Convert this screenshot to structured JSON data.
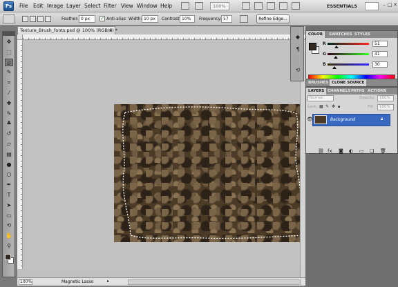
{
  "menubar": {
    "logo": "Ps",
    "items": [
      "File",
      "Edit",
      "Image",
      "Layer",
      "Select",
      "Filter",
      "View",
      "Window",
      "Help"
    ],
    "zoom": "100%",
    "workspace": "ESSENTIALS",
    "window_controls": [
      "–",
      "□",
      "✕"
    ]
  },
  "options": {
    "feather_label": "Feather:",
    "feather_value": "0 px",
    "antialias_label": "Anti-alias",
    "width_label": "Width:",
    "width_value": "10 px",
    "contrast_label": "Contrast:",
    "contrast_value": "10%",
    "frequency_label": "Frequency:",
    "frequency_value": "57",
    "refine_label": "Refine Edge..."
  },
  "toolbox": {
    "tools": [
      {
        "name": "move-tool-icon",
        "glyph": "✥"
      },
      {
        "name": "marquee-tool-icon",
        "glyph": "⬚"
      },
      {
        "name": "lasso-tool-icon",
        "glyph": "ᘐ"
      },
      {
        "name": "quick-selection-tool-icon",
        "glyph": "✎"
      },
      {
        "name": "crop-tool-icon",
        "glyph": "⌗"
      },
      {
        "name": "eyedropper-tool-icon",
        "glyph": "⁄"
      },
      {
        "name": "healing-brush-tool-icon",
        "glyph": "✚"
      },
      {
        "name": "brush-tool-icon",
        "glyph": "✎"
      },
      {
        "name": "clone-stamp-tool-icon",
        "glyph": "♣"
      },
      {
        "name": "history-brush-tool-icon",
        "glyph": "↺"
      },
      {
        "name": "eraser-tool-icon",
        "glyph": "▱"
      },
      {
        "name": "gradient-tool-icon",
        "glyph": "▤"
      },
      {
        "name": "blur-tool-icon",
        "glyph": "●"
      },
      {
        "name": "dodge-tool-icon",
        "glyph": "○"
      },
      {
        "name": "pen-tool-icon",
        "glyph": "✒"
      },
      {
        "name": "type-tool-icon",
        "glyph": "T"
      },
      {
        "name": "path-selection-tool-icon",
        "glyph": "➤"
      },
      {
        "name": "shape-tool-icon",
        "glyph": "▭"
      },
      {
        "name": "3d-rotate-tool-icon",
        "glyph": "⟲"
      },
      {
        "name": "hand-tool-icon",
        "glyph": "✋"
      },
      {
        "name": "zoom-tool-icon",
        "glyph": "⚲"
      }
    ],
    "active_tool_index": 2,
    "foreground_color": "#33291e",
    "background_color": "#ffffff"
  },
  "document": {
    "tab_title": "Texture_Brush_fonts.psd @ 100% (RGB/8) *",
    "close_glyph": "×"
  },
  "statusbar": {
    "zoom": "100%",
    "tool_info": "Magnetic Lasso",
    "arrow": "▸"
  },
  "color_panel": {
    "tabs": [
      "COLOR",
      "SWATCHES",
      "STYLES"
    ],
    "channels": [
      {
        "label": "R",
        "value": "51"
      },
      {
        "label": "G",
        "value": "41"
      },
      {
        "label": "B",
        "value": "30"
      }
    ]
  },
  "clone_panel": {
    "tabs": [
      "BRUSHES",
      "CLONE SOURCE"
    ]
  },
  "layers_panel": {
    "tabs": [
      "LAYERS",
      "CHANNELS",
      "PATHS",
      "ACTIONS"
    ],
    "blend_mode": "Normal",
    "opacity_label": "Opacity:",
    "opacity_value": "100%",
    "lock_label": "Lock:",
    "fill_label": "Fill:",
    "fill_value": "100%",
    "layers": [
      {
        "name": "Background",
        "locked": true,
        "visible": true
      }
    ],
    "footer_icons": [
      "link-icon",
      "fx-icon",
      "mask-icon",
      "adjustment-icon",
      "group-icon",
      "new-layer-icon",
      "trash-icon"
    ]
  },
  "colors": {
    "selected_layer": "#3968c1",
    "texture_base": "#4a3a26"
  }
}
